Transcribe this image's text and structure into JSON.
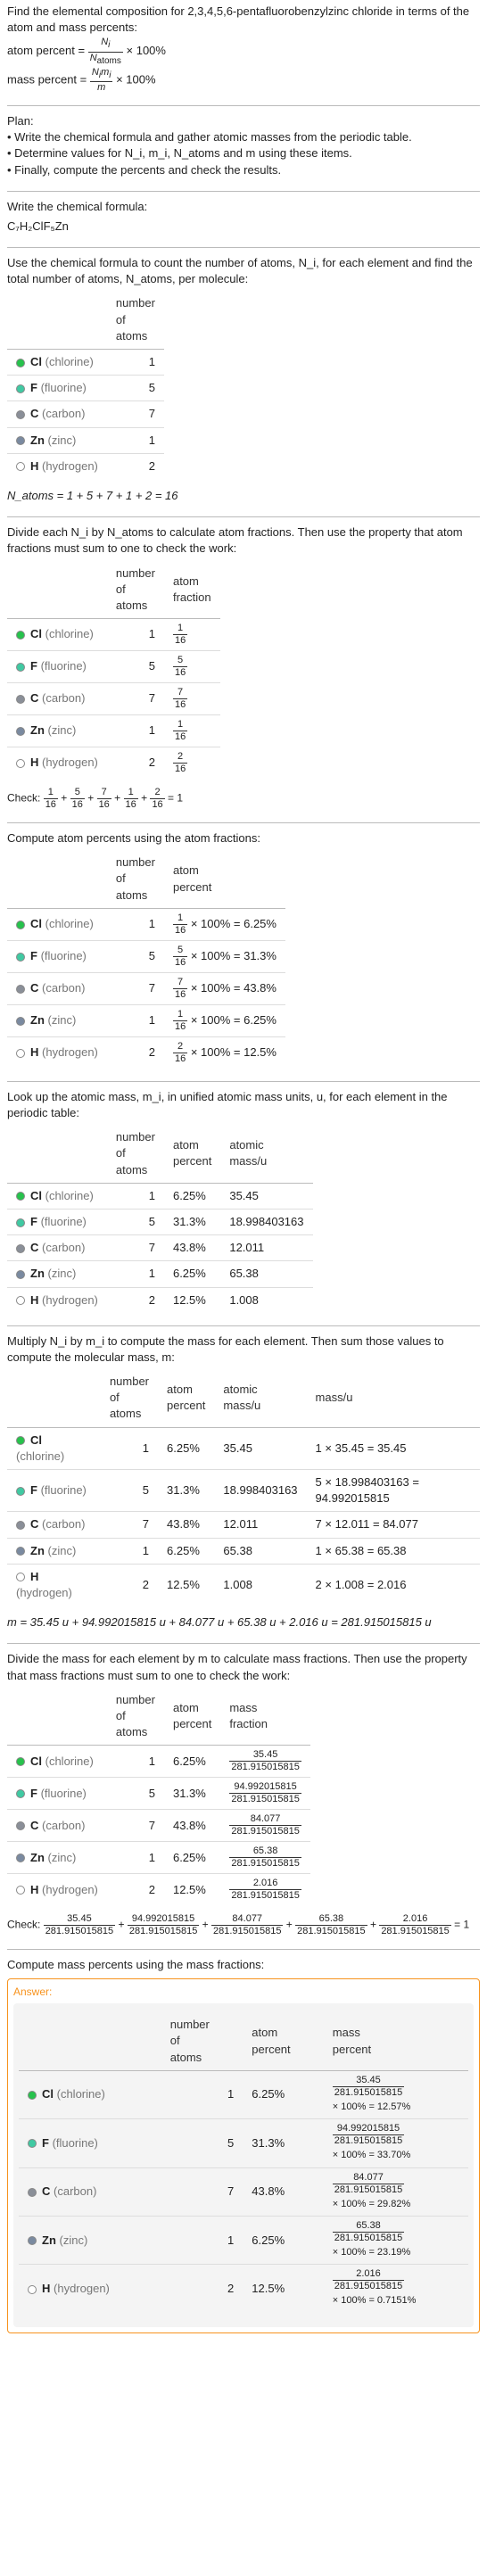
{
  "title": "Find the elemental composition for 2,3,4,5,6-pentafluorobenzylzinc chloride in terms of the atom and mass percents:",
  "defs": {
    "atom_percent": "atom percent =",
    "atom_percent_rhs": "× 100%",
    "mass_percent": "mass percent =",
    "mass_percent_rhs": "× 100%",
    "Ni": "N_i",
    "Natoms": "N_atoms",
    "Nimi": "N_i m_i",
    "m": "m"
  },
  "plan": {
    "label": "Plan:",
    "items": [
      "• Write the chemical formula and gather atomic masses from the periodic table.",
      "• Determine values for N_i, m_i, N_atoms and m using these items.",
      "• Finally, compute the percents and check the results."
    ]
  },
  "chem": {
    "label": "Write the chemical formula:",
    "formula": "C₇H₂ClF₅Zn"
  },
  "count_intro": "Use the chemical formula to count the number of atoms, N_i, for each element and find the total number of atoms, N_atoms, per molecule:",
  "table1": {
    "headers": [
      "",
      "number of atoms"
    ],
    "rows": [
      {
        "dot": "dot-cl",
        "sym": "Cl",
        "name": "(chlorine)",
        "n": "1"
      },
      {
        "dot": "dot-f",
        "sym": "F",
        "name": "(fluorine)",
        "n": "5"
      },
      {
        "dot": "dot-c",
        "sym": "C",
        "name": "(carbon)",
        "n": "7"
      },
      {
        "dot": "dot-zn",
        "sym": "Zn",
        "name": "(zinc)",
        "n": "1"
      },
      {
        "dot": "dot-h",
        "sym": "H",
        "name": "(hydrogen)",
        "n": "2"
      }
    ]
  },
  "natoms_line": "N_atoms = 1 + 5 + 7 + 1 + 2 = 16",
  "atom_frac_intro": "Divide each N_i by N_atoms to calculate atom fractions. Then use the property that atom fractions must sum to one to check the work:",
  "table2": {
    "headers": [
      "",
      "number of atoms",
      "atom fraction"
    ],
    "rows": [
      {
        "dot": "dot-cl",
        "sym": "Cl",
        "name": "(chlorine)",
        "n": "1",
        "fnum": "1",
        "fden": "16"
      },
      {
        "dot": "dot-f",
        "sym": "F",
        "name": "(fluorine)",
        "n": "5",
        "fnum": "5",
        "fden": "16"
      },
      {
        "dot": "dot-c",
        "sym": "C",
        "name": "(carbon)",
        "n": "7",
        "fnum": "7",
        "fden": "16"
      },
      {
        "dot": "dot-zn",
        "sym": "Zn",
        "name": "(zinc)",
        "n": "1",
        "fnum": "1",
        "fden": "16"
      },
      {
        "dot": "dot-h",
        "sym": "H",
        "name": "(hydrogen)",
        "n": "2",
        "fnum": "2",
        "fden": "16"
      }
    ]
  },
  "check1": "Check: 1/16 + 5/16 + 7/16 + 1/16 + 2/16 = 1",
  "atom_pct_intro": "Compute atom percents using the atom fractions:",
  "table3": {
    "headers": [
      "",
      "number of atoms",
      "atom percent"
    ],
    "rows": [
      {
        "dot": "dot-cl",
        "sym": "Cl",
        "name": "(chlorine)",
        "n": "1",
        "fnum": "1",
        "fden": "16",
        "pct": "× 100% = 6.25%"
      },
      {
        "dot": "dot-f",
        "sym": "F",
        "name": "(fluorine)",
        "n": "5",
        "fnum": "5",
        "fden": "16",
        "pct": "× 100% = 31.3%"
      },
      {
        "dot": "dot-c",
        "sym": "C",
        "name": "(carbon)",
        "n": "7",
        "fnum": "7",
        "fden": "16",
        "pct": "× 100% = 43.8%"
      },
      {
        "dot": "dot-zn",
        "sym": "Zn",
        "name": "(zinc)",
        "n": "1",
        "fnum": "1",
        "fden": "16",
        "pct": "× 100% = 6.25%"
      },
      {
        "dot": "dot-h",
        "sym": "H",
        "name": "(hydrogen)",
        "n": "2",
        "fnum": "2",
        "fden": "16",
        "pct": "× 100% = 12.5%"
      }
    ]
  },
  "mass_lookup_intro": "Look up the atomic mass, m_i, in unified atomic mass units, u, for each element in the periodic table:",
  "table4": {
    "headers": [
      "",
      "number of atoms",
      "atom percent",
      "atomic mass/u"
    ],
    "rows": [
      {
        "dot": "dot-cl",
        "sym": "Cl",
        "name": "(chlorine)",
        "n": "1",
        "pct": "6.25%",
        "mass": "35.45"
      },
      {
        "dot": "dot-f",
        "sym": "F",
        "name": "(fluorine)",
        "n": "5",
        "pct": "31.3%",
        "mass": "18.998403163"
      },
      {
        "dot": "dot-c",
        "sym": "C",
        "name": "(carbon)",
        "n": "7",
        "pct": "43.8%",
        "mass": "12.011"
      },
      {
        "dot": "dot-zn",
        "sym": "Zn",
        "name": "(zinc)",
        "n": "1",
        "pct": "6.25%",
        "mass": "65.38"
      },
      {
        "dot": "dot-h",
        "sym": "H",
        "name": "(hydrogen)",
        "n": "2",
        "pct": "12.5%",
        "mass": "1.008"
      }
    ]
  },
  "molmass_intro": "Multiply N_i by m_i to compute the mass for each element. Then sum those values to compute the molecular mass, m:",
  "table5": {
    "headers": [
      "",
      "number of atoms",
      "atom percent",
      "atomic mass/u",
      "mass/u"
    ],
    "rows": [
      {
        "dot": "dot-cl",
        "sym": "Cl",
        "name": "(chlorine)",
        "n": "1",
        "pct": "6.25%",
        "mass": "35.45",
        "calc": "1 × 35.45 = 35.45"
      },
      {
        "dot": "dot-f",
        "sym": "F",
        "name": "(fluorine)",
        "n": "5",
        "pct": "31.3%",
        "mass": "18.998403163",
        "calc": "5 × 18.998403163 = 94.992015815"
      },
      {
        "dot": "dot-c",
        "sym": "C",
        "name": "(carbon)",
        "n": "7",
        "pct": "43.8%",
        "mass": "12.011",
        "calc": "7 × 12.011 = 84.077"
      },
      {
        "dot": "dot-zn",
        "sym": "Zn",
        "name": "(zinc)",
        "n": "1",
        "pct": "6.25%",
        "mass": "65.38",
        "calc": "1 × 65.38 = 65.38"
      },
      {
        "dot": "dot-h",
        "sym": "H",
        "name": "(hydrogen)",
        "n": "2",
        "pct": "12.5%",
        "mass": "1.008",
        "calc": "2 × 1.008 = 2.016"
      }
    ]
  },
  "m_line": "m = 35.45 u + 94.992015815 u + 84.077 u + 65.38 u + 2.016 u = 281.915015815 u",
  "massfrac_intro": "Divide the mass for each element by m to calculate mass fractions. Then use the property that mass fractions must sum to one to check the work:",
  "table6": {
    "headers": [
      "",
      "number of atoms",
      "atom percent",
      "mass fraction"
    ],
    "rows": [
      {
        "dot": "dot-cl",
        "sym": "Cl",
        "name": "(chlorine)",
        "n": "1",
        "pct": "6.25%",
        "fnum": "35.45",
        "fden": "281.915015815"
      },
      {
        "dot": "dot-f",
        "sym": "F",
        "name": "(fluorine)",
        "n": "5",
        "pct": "31.3%",
        "fnum": "94.992015815",
        "fden": "281.915015815"
      },
      {
        "dot": "dot-c",
        "sym": "C",
        "name": "(carbon)",
        "n": "7",
        "pct": "43.8%",
        "fnum": "84.077",
        "fden": "281.915015815"
      },
      {
        "dot": "dot-zn",
        "sym": "Zn",
        "name": "(zinc)",
        "n": "1",
        "pct": "6.25%",
        "fnum": "65.38",
        "fden": "281.915015815"
      },
      {
        "dot": "dot-h",
        "sym": "H",
        "name": "(hydrogen)",
        "n": "2",
        "pct": "12.5%",
        "fnum": "2.016",
        "fden": "281.915015815"
      }
    ]
  },
  "check2_prefix": "Check:",
  "check2_terms": [
    {
      "num": "35.45",
      "den": "281.915015815"
    },
    {
      "num": "94.992015815",
      "den": "281.915015815"
    },
    {
      "num": "84.077",
      "den": "281.915015815"
    },
    {
      "num": "65.38",
      "den": "281.915015815"
    },
    {
      "num": "2.016",
      "den": "281.915015815"
    }
  ],
  "check2_suffix": "= 1",
  "masspct_intro": "Compute mass percents using the mass fractions:",
  "answer_label": "Answer:",
  "table7": {
    "headers": [
      "",
      "number of atoms",
      "atom percent",
      "mass percent"
    ],
    "rows": [
      {
        "dot": "dot-cl",
        "sym": "Cl",
        "name": "(chlorine)",
        "n": "1",
        "pct": "6.25%",
        "fnum": "35.45",
        "fden": "281.915015815",
        "res": "× 100% = 12.57%"
      },
      {
        "dot": "dot-f",
        "sym": "F",
        "name": "(fluorine)",
        "n": "5",
        "pct": "31.3%",
        "fnum": "94.992015815",
        "fden": "281.915015815",
        "res": "× 100% = 33.70%"
      },
      {
        "dot": "dot-c",
        "sym": "C",
        "name": "(carbon)",
        "n": "7",
        "pct": "43.8%",
        "fnum": "84.077",
        "fden": "281.915015815",
        "res": "× 100% = 29.82%"
      },
      {
        "dot": "dot-zn",
        "sym": "Zn",
        "name": "(zinc)",
        "n": "1",
        "pct": "6.25%",
        "fnum": "65.38",
        "fden": "281.915015815",
        "res": "× 100% = 23.19%"
      },
      {
        "dot": "dot-h",
        "sym": "H",
        "name": "(hydrogen)",
        "n": "2",
        "pct": "12.5%",
        "fnum": "2.016",
        "fden": "281.915015815",
        "res": "× 100% = 0.7151%"
      }
    ]
  }
}
